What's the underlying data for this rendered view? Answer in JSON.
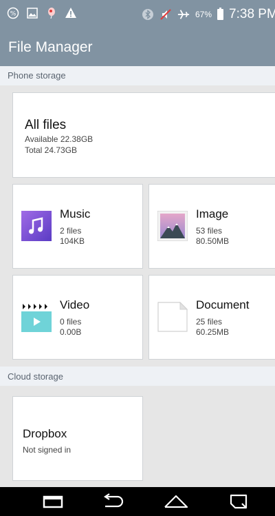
{
  "status_bar": {
    "battery": "67%",
    "time": "7:38 PM",
    "icons": [
      "data-saver-icon",
      "screenshot-icon",
      "balloon-icon",
      "warning-icon",
      "bluetooth-icon",
      "mute-icon",
      "airplane-icon",
      "battery-icon"
    ]
  },
  "app_bar": {
    "title": "File Manager"
  },
  "phone_storage": {
    "label": "Phone storage",
    "all_files": {
      "title": "All files",
      "available": "Available 22.38GB",
      "total": "Total 24.73GB"
    },
    "categories": [
      {
        "title": "Music",
        "count": "2 files",
        "size": "104KB",
        "icon": "music-icon",
        "color": "#7d4fd3"
      },
      {
        "title": "Image",
        "count": "53 files",
        "size": "80.50MB",
        "icon": "image-icon",
        "color": "#d26a7a"
      },
      {
        "title": "Video",
        "count": "0 files",
        "size": "0.00B",
        "icon": "video-icon",
        "color": "#6fd3d8"
      },
      {
        "title": "Document",
        "count": "25 files",
        "size": "60.25MB",
        "icon": "document-icon",
        "color": "#ffffff"
      }
    ]
  },
  "cloud_storage": {
    "label": "Cloud storage",
    "dropbox": {
      "title": "Dropbox",
      "status": "Not signed in"
    }
  },
  "nav_bar": {
    "buttons": [
      "recent-apps-icon",
      "back-icon",
      "home-icon",
      "menu-icon"
    ]
  }
}
